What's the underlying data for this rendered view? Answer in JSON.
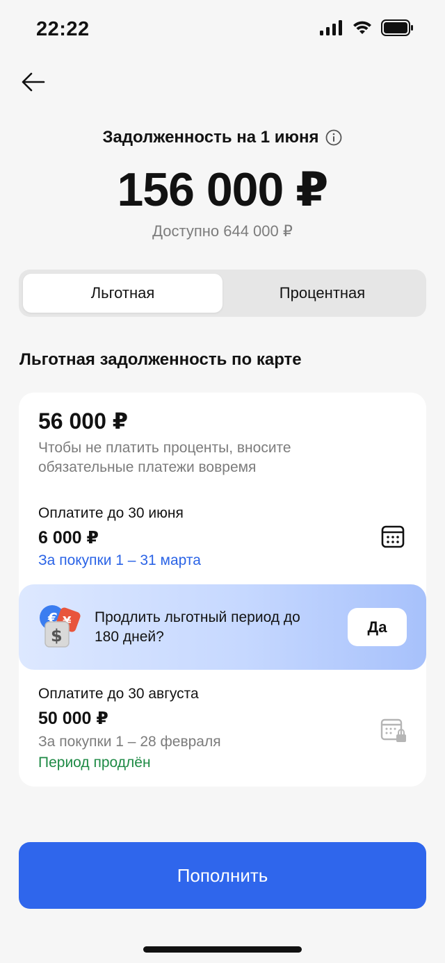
{
  "status_bar": {
    "time": "22:22",
    "icons": [
      "signal-icon",
      "wifi-icon",
      "battery-icon"
    ]
  },
  "header": {
    "back_icon": "arrow-left-icon",
    "title": "Задолженность на 1 июня",
    "info_icon": "info-icon",
    "amount": "156 000 ₽",
    "available": "Доступно 644 000 ₽"
  },
  "tabs": {
    "items": [
      {
        "label": "Льготная",
        "active": true
      },
      {
        "label": "Процентная",
        "active": false
      }
    ]
  },
  "section_title": "Льготная задолженность по карте",
  "card": {
    "amount": "56 000 ₽",
    "hint": "Чтобы не платить проценты, вносите обязательные платежи вовремя",
    "payments": [
      {
        "label": "Оплатите до 30 июня",
        "amount": "6 000 ₽",
        "subtitle": "За покупки 1 – 31 марта",
        "icon": "calendar-icon"
      },
      {
        "label": "Оплатите до 30 августа",
        "amount": "50 000 ₽",
        "subtitle": "За покупки 1 – 28 февраля",
        "status": "Период продлён",
        "icon": "calendar-locked-icon"
      }
    ],
    "promo": {
      "text": "Продлить льготный период до 180 дней?",
      "button": "Да",
      "icon": "currency-coins-icon"
    }
  },
  "colors": {
    "accent": "#2f66ec",
    "link": "#2a63e6",
    "success": "#1e8a45",
    "background": "#f6f6f6"
  },
  "topup_button": "Пополнить"
}
